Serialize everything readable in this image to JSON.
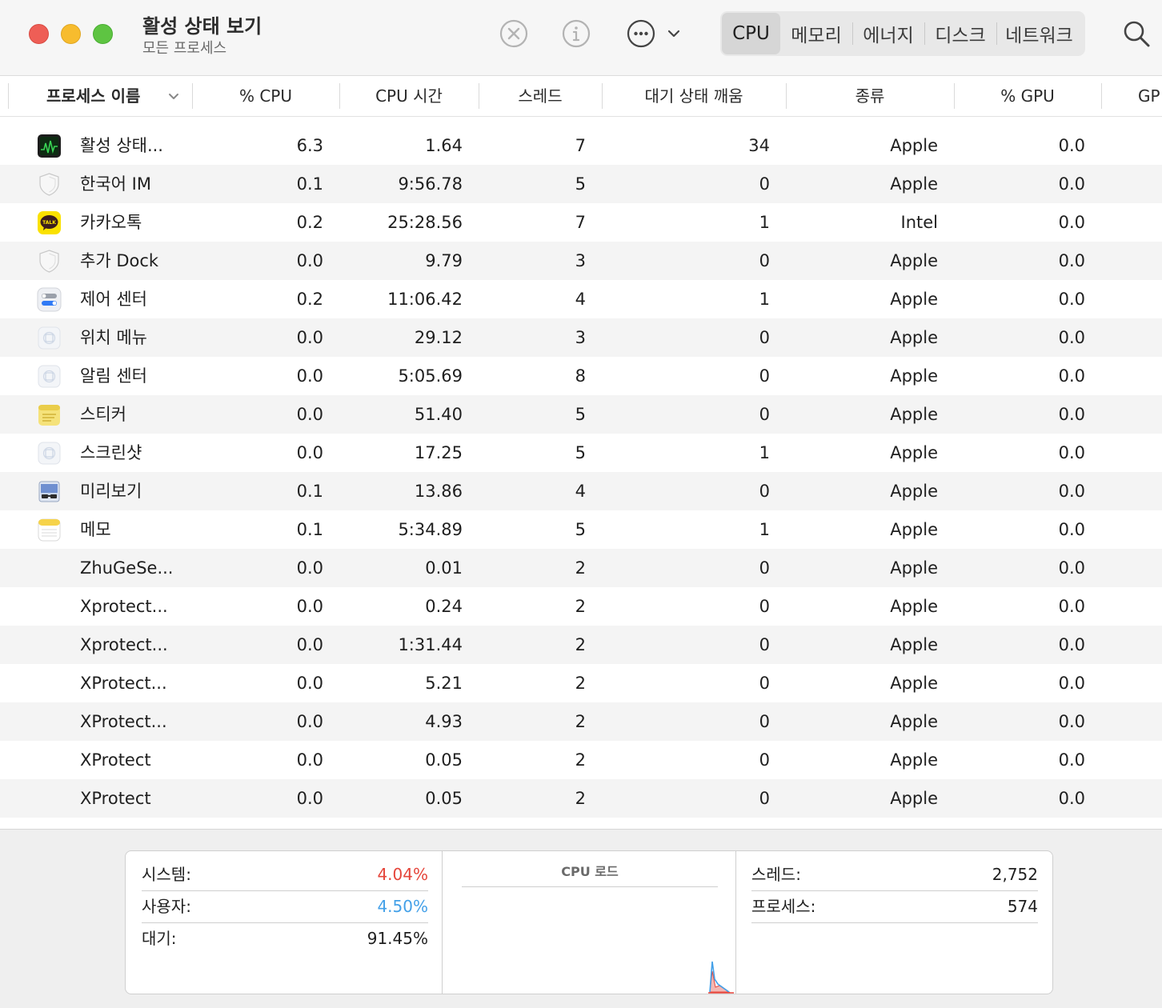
{
  "window": {
    "title": "활성 상태 보기",
    "subtitle": "모든 프로세스"
  },
  "toolbar": {
    "stop_icon": "x-circle-icon",
    "info_icon": "info-icon",
    "more_icon": "ellipsis-circle-icon",
    "search_icon": "magnifying-glass-icon",
    "tabs": [
      "CPU",
      "메모리",
      "에너지",
      "디스크",
      "네트워크"
    ],
    "active_tab": "CPU"
  },
  "table": {
    "columns": [
      "프로세스 이름",
      "% CPU",
      "CPU 시간",
      "스레드",
      "대기 상태 깨움",
      "종류",
      "% GPU",
      "GP"
    ],
    "sort_column": "프로세스 이름",
    "rows": [
      {
        "icon": "activity-monitor-icon",
        "name": "활성 상태...",
        "cpu": "6.3",
        "time": "1.64",
        "threads": "7",
        "wakes": "34",
        "kind": "Apple",
        "gpu": "0.0"
      },
      {
        "icon": "shield-icon",
        "name": "한국어 IM",
        "cpu": "0.1",
        "time": "9:56.78",
        "threads": "5",
        "wakes": "0",
        "kind": "Apple",
        "gpu": "0.0"
      },
      {
        "icon": "kakaotalk-icon",
        "name": "카카오톡",
        "cpu": "0.2",
        "time": "25:28.56",
        "threads": "7",
        "wakes": "1",
        "kind": "Intel",
        "gpu": "0.0"
      },
      {
        "icon": "shield-icon",
        "name": "추가 Dock",
        "cpu": "0.0",
        "time": "9.79",
        "threads": "3",
        "wakes": "0",
        "kind": "Apple",
        "gpu": "0.0"
      },
      {
        "icon": "control-center-icon",
        "name": "제어 센터",
        "cpu": "0.2",
        "time": "11:06.42",
        "threads": "4",
        "wakes": "1",
        "kind": "Apple",
        "gpu": "0.0"
      },
      {
        "icon": "generic-app-icon",
        "name": "위치 메뉴",
        "cpu": "0.0",
        "time": "29.12",
        "threads": "3",
        "wakes": "0",
        "kind": "Apple",
        "gpu": "0.0"
      },
      {
        "icon": "generic-app-icon",
        "name": "알림 센터",
        "cpu": "0.0",
        "time": "5:05.69",
        "threads": "8",
        "wakes": "0",
        "kind": "Apple",
        "gpu": "0.0"
      },
      {
        "icon": "stickies-icon",
        "name": "스티커",
        "cpu": "0.0",
        "time": "51.40",
        "threads": "5",
        "wakes": "0",
        "kind": "Apple",
        "gpu": "0.0"
      },
      {
        "icon": "generic-app-icon",
        "name": "스크린샷",
        "cpu": "0.0",
        "time": "17.25",
        "threads": "5",
        "wakes": "1",
        "kind": "Apple",
        "gpu": "0.0"
      },
      {
        "icon": "preview-icon",
        "name": "미리보기",
        "cpu": "0.1",
        "time": "13.86",
        "threads": "4",
        "wakes": "0",
        "kind": "Apple",
        "gpu": "0.0"
      },
      {
        "icon": "notes-icon",
        "name": "메모",
        "cpu": "0.1",
        "time": "5:34.89",
        "threads": "5",
        "wakes": "1",
        "kind": "Apple",
        "gpu": "0.0"
      },
      {
        "icon": "",
        "name": "ZhuGeSe...",
        "cpu": "0.0",
        "time": "0.01",
        "threads": "2",
        "wakes": "0",
        "kind": "Apple",
        "gpu": "0.0"
      },
      {
        "icon": "",
        "name": "Xprotect...",
        "cpu": "0.0",
        "time": "0.24",
        "threads": "2",
        "wakes": "0",
        "kind": "Apple",
        "gpu": "0.0"
      },
      {
        "icon": "",
        "name": "Xprotect...",
        "cpu": "0.0",
        "time": "1:31.44",
        "threads": "2",
        "wakes": "0",
        "kind": "Apple",
        "gpu": "0.0"
      },
      {
        "icon": "",
        "name": "XProtect...",
        "cpu": "0.0",
        "time": "5.21",
        "threads": "2",
        "wakes": "0",
        "kind": "Apple",
        "gpu": "0.0"
      },
      {
        "icon": "",
        "name": "XProtect...",
        "cpu": "0.0",
        "time": "4.93",
        "threads": "2",
        "wakes": "0",
        "kind": "Apple",
        "gpu": "0.0"
      },
      {
        "icon": "",
        "name": "XProtect",
        "cpu": "0.0",
        "time": "0.05",
        "threads": "2",
        "wakes": "0",
        "kind": "Apple",
        "gpu": "0.0"
      },
      {
        "icon": "",
        "name": "XProtect",
        "cpu": "0.0",
        "time": "0.05",
        "threads": "2",
        "wakes": "0",
        "kind": "Apple",
        "gpu": "0.0"
      }
    ]
  },
  "summary": {
    "system_label": "시스템:",
    "system_value": "4.04%",
    "user_label": "사용자:",
    "user_value": "4.50%",
    "idle_label": "대기:",
    "idle_value": "91.45%",
    "load_title": "CPU 로드",
    "threads_label": "스레드:",
    "threads_value": "2,752",
    "processes_label": "프로세스:",
    "processes_value": "574"
  },
  "colors": {
    "system": "#e5453b",
    "user": "#43a0e8"
  }
}
